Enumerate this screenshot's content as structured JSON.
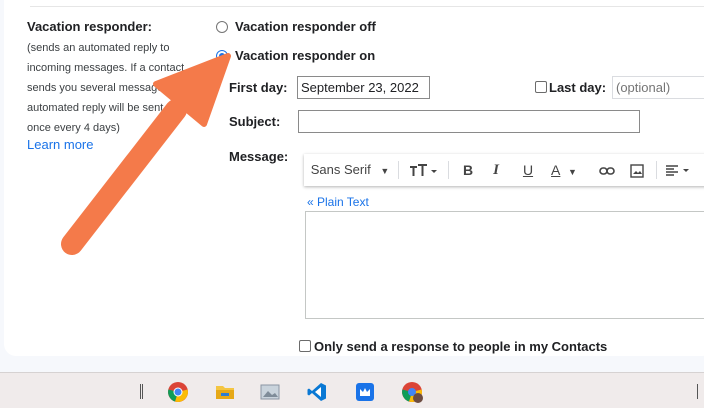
{
  "vacation": {
    "title": "Vacation responder:",
    "description": "(sends an automated reply to incoming messages. If a contact sends you several messages, this automated reply will be sent at most once every 4 days)",
    "learn_more": "Learn more",
    "option_off": "Vacation responder off",
    "option_on": "Vacation responder on",
    "selected": "on"
  },
  "form": {
    "first_day_label": "First day:",
    "first_day_value": "September 23, 2022",
    "last_day_label": "Last day:",
    "last_day_placeholder": "(optional)",
    "subject_label": "Subject:",
    "subject_value": "",
    "message_label": "Message:",
    "plain_text_link": "« Plain Text",
    "contacts_only_label": "Only send a response to people in my Contacts"
  },
  "toolbar": {
    "font": "Sans Serif",
    "bold": "B",
    "italic": "I",
    "underline": "U",
    "text_color": "A"
  },
  "taskbar": {
    "apps": [
      "chrome-icon",
      "file-explorer-icon",
      "image-viewer-icon",
      "vscode-icon",
      "store-icon",
      "chrome-profile-icon"
    ]
  },
  "colors": {
    "accent": "#1a73e8",
    "arrow": "#f47a4a"
  }
}
